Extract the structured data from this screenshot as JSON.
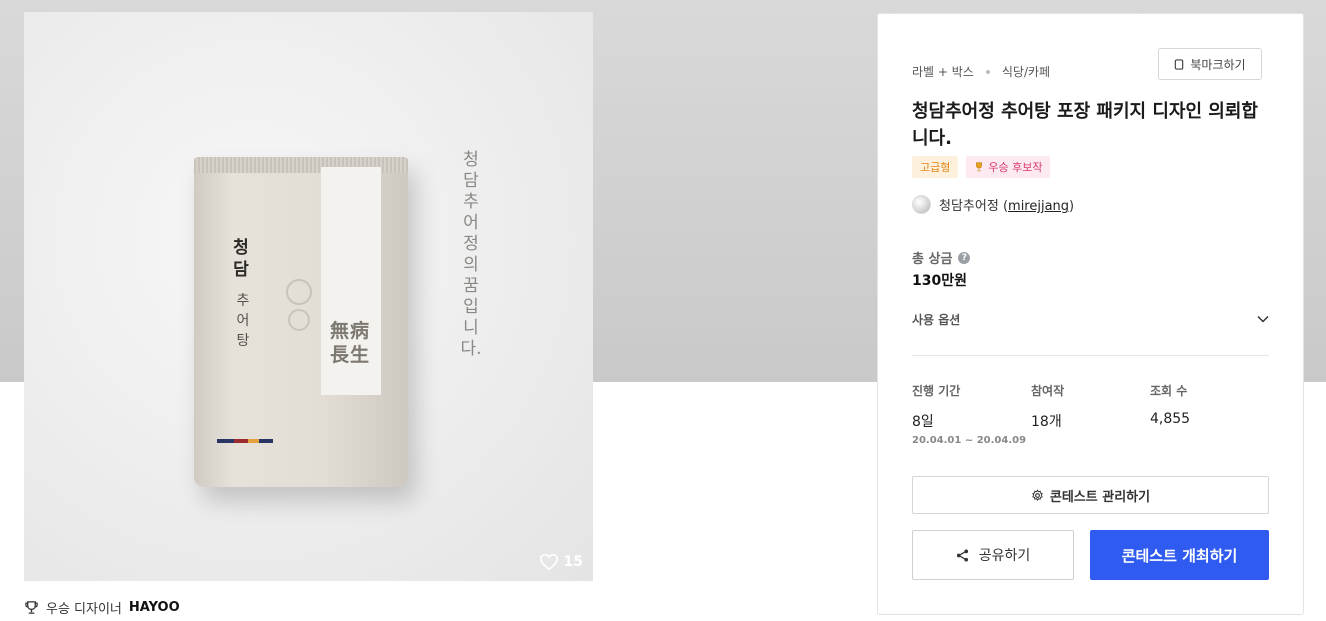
{
  "gallery": {
    "like_count": "15",
    "product_image": {
      "brand_text": "청담",
      "sub_text": "추어탕",
      "seal_text": "無病長生",
      "slogan_text": "청담추어정의꿈입니다."
    },
    "winner": {
      "label": "우승 디자이너",
      "name": "HAYOO"
    }
  },
  "contest": {
    "category_main": "라벨 + 박스",
    "category_sub": "식당/카페",
    "bookmark_label": "북마크하기",
    "title": "청담추어정 추어탕 포장 패키지 디자인 의뢰합니다.",
    "badges": {
      "premium": "고급형",
      "candidate": "우승 후보작"
    },
    "owner": {
      "name": "청담추어정",
      "handle": "mirejjang",
      "open_paren": "(",
      "close_paren": ")"
    },
    "prize_label": "총 상금",
    "prize_help": "?",
    "prize_value": "130만원",
    "option_label": "사용 옵션",
    "stats": {
      "duration_label": "진행 기간",
      "duration_value": "8일",
      "duration_range": "20.04.01 ~ 20.04.09",
      "entries_label": "참여작",
      "entries_value": "18개",
      "views_label": "조회 수",
      "views_value": "4,855"
    },
    "manage_label": "콘테스트 관리하기",
    "share_label": "공유하기",
    "host_label": "콘테스트 개최하기"
  },
  "colors": {
    "primary": "#2f5bf0",
    "premium_badge": "#e0871c",
    "candidate_badge": "#d9396f"
  }
}
